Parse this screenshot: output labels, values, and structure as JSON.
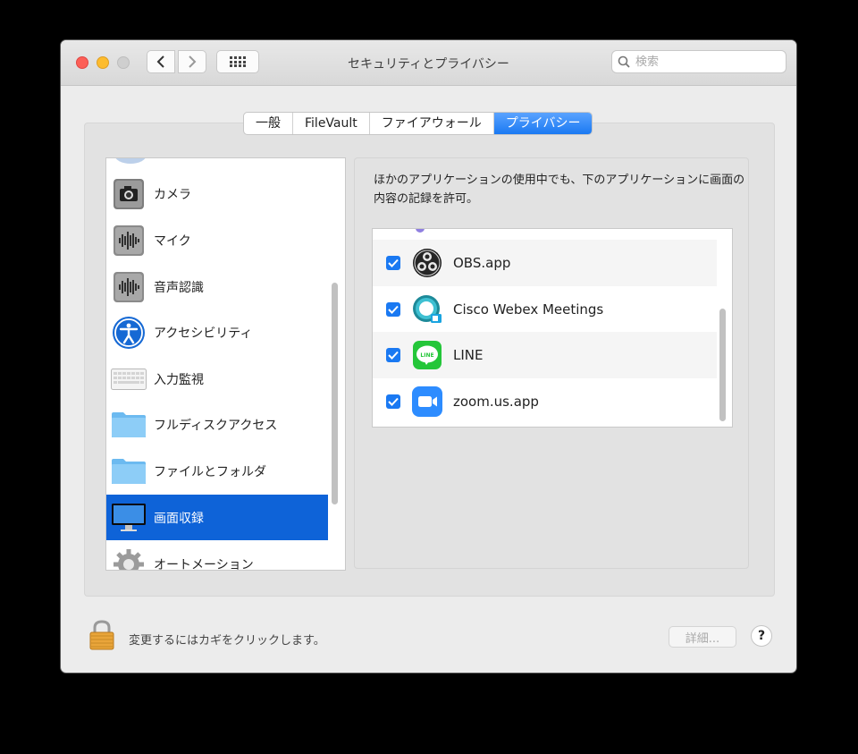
{
  "window": {
    "title": "セキュリティとプライバシー"
  },
  "toolbar": {
    "search_placeholder": "検索"
  },
  "tabs": [
    {
      "label": "一般",
      "active": false
    },
    {
      "label": "FileVault",
      "active": false
    },
    {
      "label": "ファイアウォール",
      "active": false
    },
    {
      "label": "プライバシー",
      "active": true
    }
  ],
  "sidebar": {
    "items": [
      {
        "label": "カメラ",
        "icon": "camera-icon"
      },
      {
        "label": "マイク",
        "icon": "microphone-icon"
      },
      {
        "label": "音声認識",
        "icon": "speech-recognition-icon"
      },
      {
        "label": "アクセシビリティ",
        "icon": "accessibility-icon"
      },
      {
        "label": "入力監視",
        "icon": "keyboard-icon"
      },
      {
        "label": "フルディスクアクセス",
        "icon": "folder-icon"
      },
      {
        "label": "ファイルとフォルダ",
        "icon": "folder-icon"
      },
      {
        "label": "画面収録",
        "icon": "display-icon",
        "selected": true
      },
      {
        "label": "オートメーション",
        "icon": "gear-icon"
      }
    ]
  },
  "main": {
    "description": "ほかのアプリケーションの使用中でも、下のアプリケーションに画面の内容の記録を許可。",
    "apps": [
      {
        "name": "OBS.app",
        "checked": true,
        "icon": "obs-icon"
      },
      {
        "name": "Cisco Webex Meetings",
        "checked": true,
        "icon": "webex-icon"
      },
      {
        "name": "LINE",
        "checked": true,
        "icon": "line-icon"
      },
      {
        "name": "zoom.us.app",
        "checked": true,
        "icon": "zoom-icon"
      }
    ]
  },
  "footer": {
    "lock_text": "変更するにはカギをクリックします。",
    "advanced_label": "詳細...",
    "help_label": "?"
  },
  "colors": {
    "accent": "#1a79f2",
    "selection": "#0e63d8"
  }
}
